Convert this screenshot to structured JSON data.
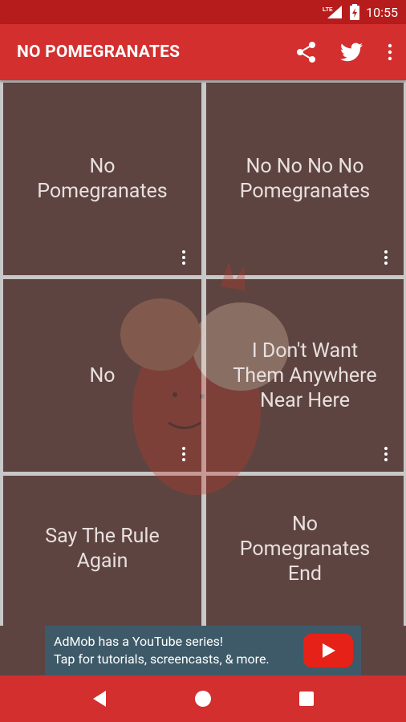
{
  "status_bar": {
    "network": "LTE",
    "time": "10:55"
  },
  "app_bar": {
    "title": "NO POMEGRANATES",
    "icons": [
      "share-icon",
      "twitter-icon",
      "more-vert-icon"
    ]
  },
  "tiles": [
    {
      "label": "No\nPomegranates"
    },
    {
      "label": "No No No No\nPomegranates"
    },
    {
      "label": "No"
    },
    {
      "label": "I Don't Want\nThem Anywhere\nNear Here"
    },
    {
      "label": "Say The Rule\nAgain"
    },
    {
      "label": "No\nPomegranates\nEnd"
    }
  ],
  "ad": {
    "line1": "AdMob has a YouTube series!",
    "line2": "Tap for tutorials, screencasts, & more."
  },
  "colors": {
    "status_bar": "#b71c1c",
    "app_bar": "#d32f2f",
    "tile": "#5d4440",
    "grid_gap": "#c8c8c8",
    "ad_banner": "#3e5a69",
    "youtube_red": "#e62117"
  }
}
